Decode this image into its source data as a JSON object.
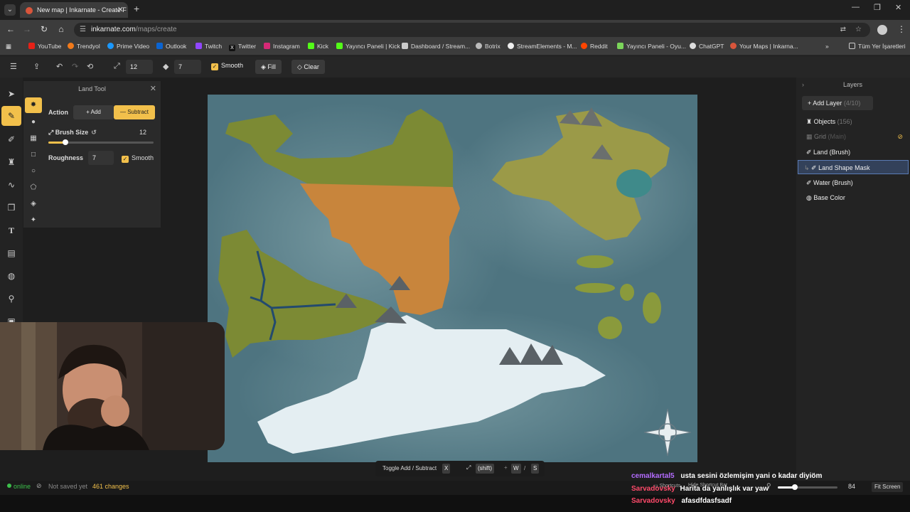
{
  "browser": {
    "tab_title": "New map | Inkarnate - Create F",
    "url_domain": "inkarnate.com",
    "url_path": "/maps/create",
    "bookmarks": [
      "YouTube",
      "Trendyol",
      "Prime Video",
      "Outlook",
      "Twitch",
      "Twitter",
      "Instagram",
      "Kick",
      "Yayıncı Paneli | Kick",
      "Dashboard / Stream...",
      "Botrix",
      "StreamElements - M...",
      "Reddit",
      "Yayıncı Paneli - Oyu...",
      "ChatGPT",
      "Your Maps | Inkarna..."
    ],
    "all_bookmarks": "Tüm Yer İşaretleri"
  },
  "toolbar": {
    "brush_size": "12",
    "roughness": "7",
    "smooth_label": "Smooth",
    "fill_label": "Fill",
    "clear_label": "Clear"
  },
  "land_panel": {
    "title": "Land Tool",
    "action_label": "Action",
    "add_label": "Add",
    "subtract_label": "Subtract",
    "brush_size_label": "Brush Size",
    "brush_size_value": "12",
    "brush_size_fraction": 0.16,
    "roughness_label": "Roughness",
    "roughness_value": "7",
    "smooth_label": "Smooth"
  },
  "layers": {
    "title": "Layers",
    "add_layer_label": "Add Layer",
    "add_layer_count": "(4/10)",
    "items": [
      {
        "label": "Objects",
        "extra": "(156)"
      },
      {
        "label": "Grid",
        "extra": "(Main)"
      },
      {
        "label": "Land (Brush)",
        "extra": ""
      },
      {
        "label": "Land Shape Mask",
        "extra": ""
      },
      {
        "label": "Water (Brush)",
        "extra": ""
      },
      {
        "label": "Base Color",
        "extra": ""
      }
    ]
  },
  "hint": {
    "toggle_label": "Toggle Add / Subtract",
    "key_x": "X",
    "key_shift": "(shift)",
    "key_w": "W",
    "sep": "/",
    "key_s": "S"
  },
  "status": {
    "online": "online",
    "saved": "Not saved yet",
    "changes": "461 changes",
    "shortcuts_label": "Shortcuts",
    "hide_shortcut_bar": "Hide Shortcut Bar",
    "zoom": "84",
    "fit_screen": "Fit Screen"
  },
  "chat": [
    {
      "user": "cemalkartal5",
      "message": "usta sesini özlemişim yani o kadar diyiöm",
      "color": "#b46cff"
    },
    {
      "user": "Sarvadovsky",
      "message": "Harita da yanlışlık var yaw",
      "color": "#ff4a6a"
    },
    {
      "user": "Sarvadovsky",
      "message": "afasdfdasfsadf",
      "color": "#ff4a6a"
    }
  ],
  "colors": {
    "accent": "#f2c04b",
    "selected_layer": "#33415a",
    "online": "#3cc04b"
  }
}
